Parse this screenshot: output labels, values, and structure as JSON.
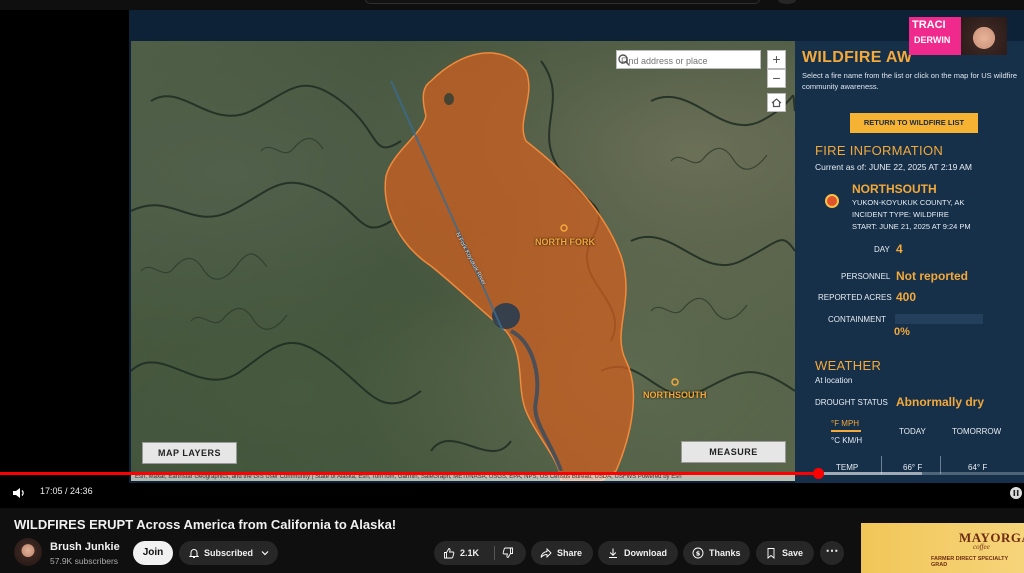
{
  "video": {
    "title": "WILDFIRES ERUPT Across America from California to Alaska!",
    "current_time": "17:05",
    "duration": "24:36",
    "time_separator": " / ",
    "progress_played": 0.7,
    "progress_buffered": 0.9
  },
  "channel": {
    "name": "Brush Junkie",
    "subscribers": "57.9K subscribers",
    "join_label": "Join",
    "subscribed_label": "Subscribed"
  },
  "actions": {
    "likes": "2.1K",
    "share": "Share",
    "download": "Download",
    "thanks": "Thanks",
    "save": "Save"
  },
  "badge": {
    "line1": "TRACI",
    "line2": "DERWIN"
  },
  "ad": {
    "brand": "MAYORGA",
    "sub": "coffee",
    "tagline": "FARMER DIRECT SPECIALTY GRAD"
  },
  "map": {
    "search_placeholder": "Find address or place",
    "layers_button": "MAP LAYERS",
    "measure_button": "MEASURE",
    "zoom_in": "+",
    "zoom_out": "−",
    "labels": {
      "north_fork": "NORTH FORK",
      "northsouth": "NORTHSOUTH",
      "river": "N Fork Koyukuk River"
    },
    "attribution": "Esri, Maxar, Earthstar Geographics, and the GIS User Community | State of Alaska, Esri, TomTom, Garmin, SafeGraph, METI/NASA, USGS, EPA, NPS, US Census Bureau, USDA, USFWS    Powered by Esri"
  },
  "panel": {
    "title": "WILDFIRE AW",
    "description": "Select a fire name from the list or click on the map for US wildfire community awareness.",
    "return_button": "RETURN TO WILDFIRE LIST",
    "fire_info_title": "FIRE INFORMATION",
    "current_as_of": "Current as of: JUNE 22, 2025 AT 2:19 AM",
    "fire_name": "NORTHSOUTH",
    "county": "YUKON-KOYUKUK COUNTY, AK",
    "incident_type": "INCIDENT TYPE: WILDFIRE",
    "start": "START: JUNE 21, 2025 AT 9:24 PM",
    "day_label": "DAY",
    "day_value": "4",
    "personnel_label": "PERSONNEL",
    "personnel_value": "Not reported",
    "acres_label": "REPORTED ACRES",
    "acres_value": "400",
    "containment_label": "CONTAINMENT",
    "containment_value": "0%",
    "containment_fraction": 0,
    "weather_title": "WEATHER",
    "at_location": "At location",
    "drought_label": "DROUGHT STATUS",
    "drought_value": "Abnormally dry",
    "unit_f": "°F MPH",
    "unit_c": "°C KM/H",
    "today": "TODAY",
    "tomorrow": "TOMORROW",
    "temp_label": "TEMP",
    "temp_today": "66° F",
    "temp_tomorrow": "64° F"
  },
  "colors": {
    "accent": "#f4a93a",
    "panel_bg": "#16304a",
    "fire_perimeter": "#d2601f",
    "progress": "#ff0000"
  }
}
